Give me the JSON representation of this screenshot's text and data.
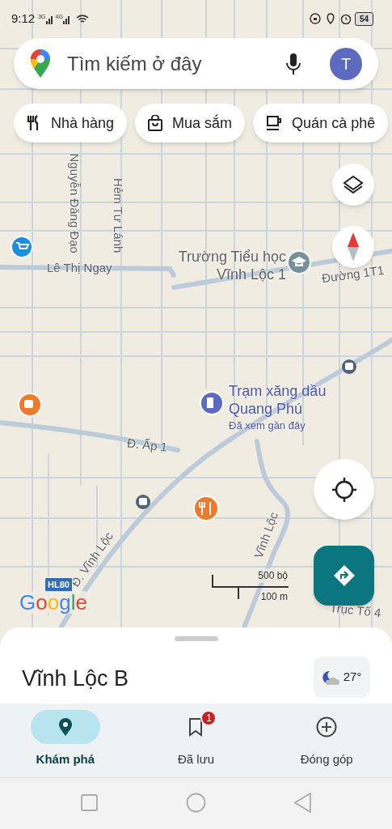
{
  "status_bar": {
    "time": "9:12",
    "networks": [
      "3G",
      "4G"
    ],
    "battery": "54"
  },
  "search": {
    "placeholder": "Tìm kiếm ở đây",
    "avatar": "T"
  },
  "chips": [
    {
      "label": "Nhà hàng",
      "kind": "restaurant"
    },
    {
      "label": "Mua sắm",
      "kind": "shopping"
    },
    {
      "label": "Quán cà phê",
      "kind": "coffee"
    }
  ],
  "map_labels": [
    {
      "text": "Lê Thị Ngay",
      "kind": "street"
    },
    {
      "text": "Nguyễn Đăng Đạo",
      "kind": "street"
    },
    {
      "text": "Hẻm Tư Lánh",
      "kind": "street"
    },
    {
      "text": "Trường Tiểu học Vĩnh Lộc 1",
      "kind": "place"
    },
    {
      "text": "Đường 1T1",
      "kind": "street"
    },
    {
      "text": "Trạm xăng dầu Quang Phú",
      "kind": "poi"
    },
    {
      "text": "Đã xem gần đây",
      "kind": "note"
    },
    {
      "text": "Đ. Ấp 1",
      "kind": "street"
    },
    {
      "text": "Đ. Vĩnh Lộc",
      "kind": "street"
    },
    {
      "text": "Vĩnh Lộc",
      "kind": "street"
    },
    {
      "text": "Trục Tố 4",
      "kind": "street"
    }
  ],
  "route_badge": "HL80",
  "map_logo": "Google",
  "scale": {
    "imperial": "500 bộ",
    "metric": "100 m"
  },
  "sheet": {
    "title": "Vĩnh Lộc B",
    "temperature": "27°"
  },
  "nav_tabs": [
    {
      "label": "Khám phá",
      "selected": true,
      "kind": "explore"
    },
    {
      "label": "Đã lưu",
      "selected": false,
      "kind": "saved",
      "badge": "1"
    },
    {
      "label": "Đóng góp",
      "selected": false,
      "kind": "contribute"
    }
  ]
}
